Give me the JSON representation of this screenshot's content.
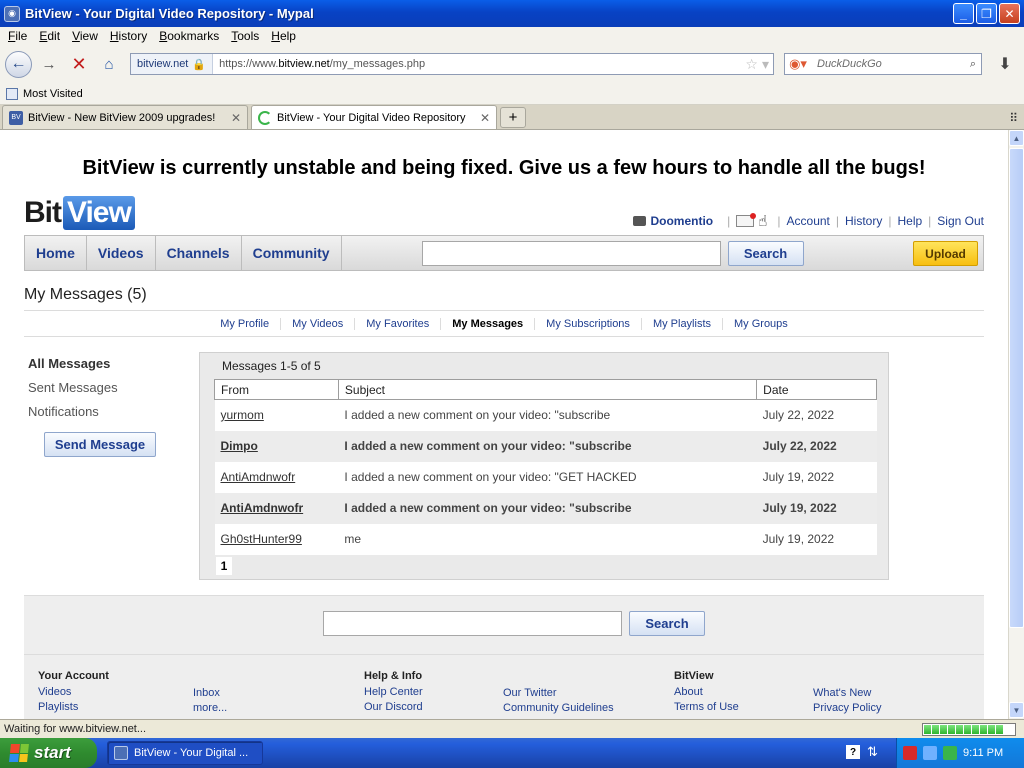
{
  "window": {
    "title": "BitView - Your Digital Video Repository - Mypal",
    "minimize": "_",
    "maximize": "❐",
    "close": "✕"
  },
  "menu": [
    "File",
    "Edit",
    "View",
    "History",
    "Bookmarks",
    "Tools",
    "Help"
  ],
  "toolbar": {
    "site_id": "bitview.net",
    "url_prefix": "https://www.",
    "url_domain": "bitview.net",
    "url_path": "/my_messages.php",
    "search_placeholder": "DuckDuckGo"
  },
  "bookmarks": {
    "most_visited": "Most Visited"
  },
  "tabs": [
    {
      "label": "BitView - New BitView 2009 upgrades!",
      "active": false
    },
    {
      "label": "BitView - Your Digital Video Repository",
      "active": true
    }
  ],
  "page": {
    "banner": "BitView is currently unstable and being fixed. Give us a few hours to handle all the bugs!",
    "logo_bit": "Bit",
    "logo_view": "View",
    "user": {
      "username": "Doomentio",
      "links": [
        "Account",
        "History",
        "Help",
        "Sign Out"
      ]
    },
    "nav": [
      "Home",
      "Videos",
      "Channels",
      "Community"
    ],
    "search_button": "Search",
    "upload_button": "Upload",
    "heading": "My Messages (5)",
    "subnav": [
      {
        "label": "My Profile",
        "current": false
      },
      {
        "label": "My Videos",
        "current": false
      },
      {
        "label": "My Favorites",
        "current": false
      },
      {
        "label": "My Messages",
        "current": true
      },
      {
        "label": "My Subscriptions",
        "current": false
      },
      {
        "label": "My Playlists",
        "current": false
      },
      {
        "label": "My Groups",
        "current": false
      }
    ],
    "leftnav": {
      "all": "All Messages",
      "sent": "Sent Messages",
      "notifications": "Notifications"
    },
    "send_message": "Send Message",
    "messages": {
      "count_text": "Messages 1-5 of 5",
      "columns": {
        "from": "From",
        "subject": "Subject",
        "date": "Date"
      },
      "rows": [
        {
          "from": "yurmom",
          "subject": "I added a new comment on your video: \"subscribe",
          "date": "July 22, 2022",
          "unread": false
        },
        {
          "from": "Dimpo",
          "subject": "I added a new comment on your video: \"subscribe",
          "date": "July 22, 2022",
          "unread": true
        },
        {
          "from": "AntiAmdnwofr",
          "subject": "I added a new comment on your video: \"GET HACKED",
          "date": "July 19, 2022",
          "unread": false
        },
        {
          "from": "AntiAmdnwofr",
          "subject": "I added a new comment on your video: \"subscribe",
          "date": "July 19, 2022",
          "unread": true
        },
        {
          "from": "Gh0stHunter99",
          "subject": "me",
          "date": "July 19, 2022",
          "unread": false
        }
      ],
      "page": "1"
    },
    "footer": {
      "search_button": "Search",
      "your_account": {
        "title": "Your Account",
        "links_a": [
          "Videos",
          "Playlists"
        ],
        "links_b": [
          "Inbox",
          "more..."
        ]
      },
      "help": {
        "title": "Help & Info",
        "links_a": [
          "Help Center",
          "Our Discord"
        ],
        "links_b": [
          "Our Twitter",
          "Community Guidelines"
        ]
      },
      "bitview": {
        "title": "BitView",
        "links_a": [
          "About",
          "Terms of Use"
        ],
        "links_b": [
          "What's New",
          "Privacy Policy"
        ]
      }
    }
  },
  "status": {
    "text": "Waiting for www.bitview.net...",
    "progress_segments": 10
  },
  "taskbar": {
    "start": "start",
    "task": "BitView - Your Digital ...",
    "clock": "9:11 PM"
  },
  "colors": {
    "link": "#1f3e8f",
    "upload": "#f7bf11",
    "taskbar": "#245edb",
    "start": "#2f8b2f"
  }
}
